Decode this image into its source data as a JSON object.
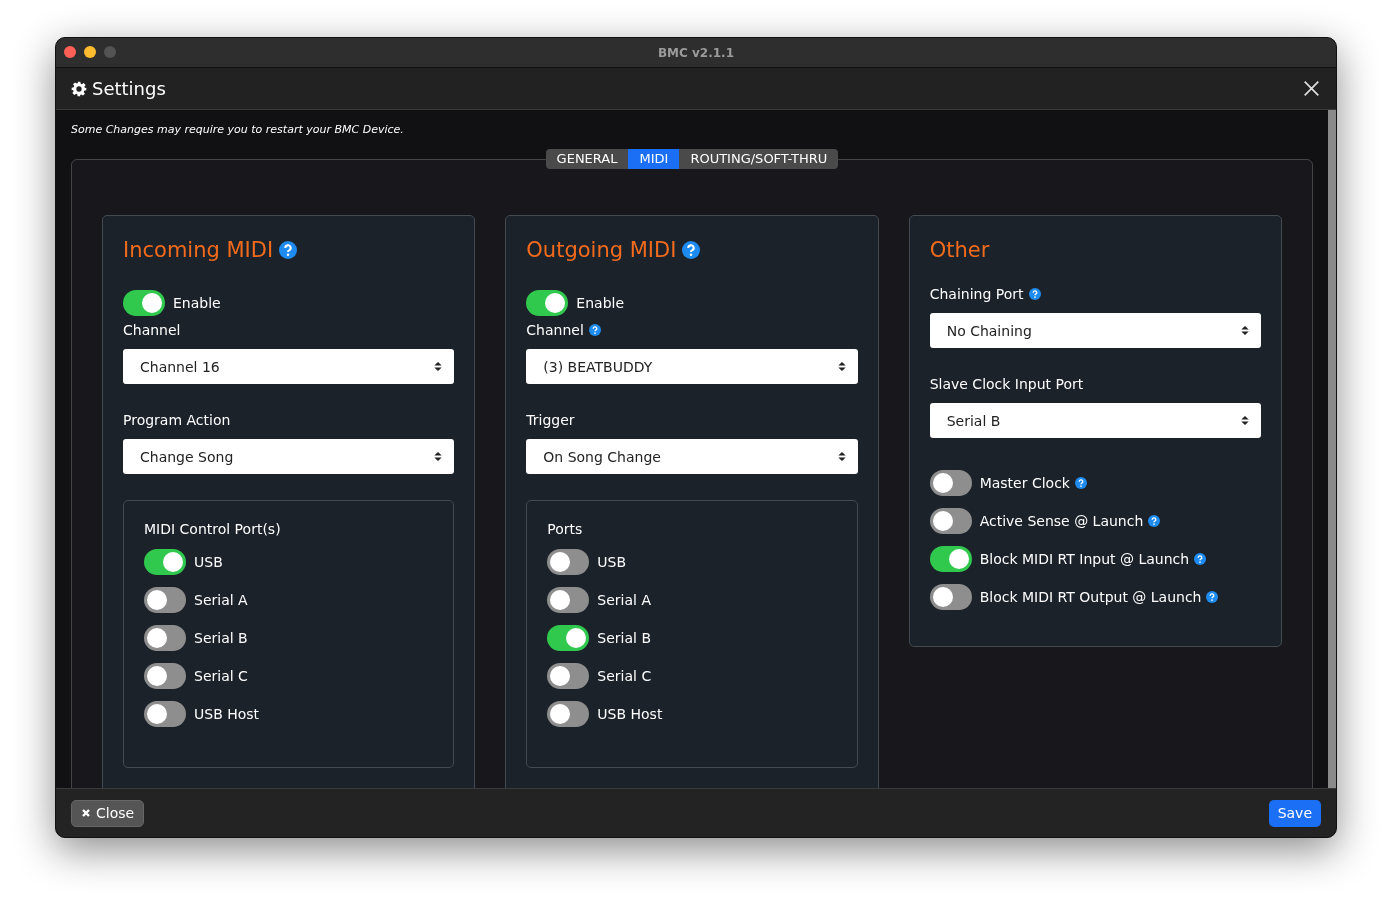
{
  "window": {
    "title": "BMC v2.1.1"
  },
  "header": {
    "title": "Settings"
  },
  "notice": "Some Changes may require you to restart your BMC Device.",
  "tabs": [
    {
      "label": "GENERAL",
      "selected": false
    },
    {
      "label": "MIDI",
      "selected": true
    },
    {
      "label": "ROUTING/SOFT-THRU",
      "selected": false
    }
  ],
  "panels": [
    {
      "title": "Incoming MIDI",
      "help": true,
      "items": [
        {
          "kind": "toggle",
          "label": "Enable",
          "on": true,
          "help": false
        },
        {
          "kind": "select",
          "label": "Channel",
          "help": false,
          "value": "Channel 16"
        },
        {
          "kind": "select",
          "label": "Program Action",
          "help": false,
          "value": "Change Song"
        },
        {
          "kind": "group",
          "title": "MIDI Control Port(s)",
          "items": [
            {
              "kind": "toggle",
              "label": "USB",
              "on": true,
              "help": false
            },
            {
              "kind": "toggle",
              "label": "Serial A",
              "on": false,
              "help": false
            },
            {
              "kind": "toggle",
              "label": "Serial B",
              "on": false,
              "help": false
            },
            {
              "kind": "toggle",
              "label": "Serial C",
              "on": false,
              "help": false
            },
            {
              "kind": "toggle",
              "label": "USB Host",
              "on": false,
              "help": false
            }
          ]
        }
      ]
    },
    {
      "title": "Outgoing MIDI",
      "help": true,
      "items": [
        {
          "kind": "toggle",
          "label": "Enable",
          "on": true,
          "help": false
        },
        {
          "kind": "select",
          "label": "Channel",
          "help": true,
          "value": "(3) BEATBUDDY"
        },
        {
          "kind": "select",
          "label": "Trigger",
          "help": false,
          "value": "On Song Change"
        },
        {
          "kind": "group",
          "title": "Ports",
          "items": [
            {
              "kind": "toggle",
              "label": "USB",
              "on": false,
              "help": false
            },
            {
              "kind": "toggle",
              "label": "Serial A",
              "on": false,
              "help": false
            },
            {
              "kind": "toggle",
              "label": "Serial B",
              "on": true,
              "help": false
            },
            {
              "kind": "toggle",
              "label": "Serial C",
              "on": false,
              "help": false
            },
            {
              "kind": "toggle",
              "label": "USB Host",
              "on": false,
              "help": false
            }
          ]
        }
      ]
    },
    {
      "title": "Other",
      "help": false,
      "items": [
        {
          "kind": "select",
          "label": "Chaining Port",
          "help": true,
          "value": "No Chaining"
        },
        {
          "kind": "select",
          "label": "Slave Clock Input Port",
          "help": false,
          "value": "Serial B"
        },
        {
          "kind": "toggle",
          "label": "Master Clock",
          "on": false,
          "help": true
        },
        {
          "kind": "toggle",
          "label": "Active Sense @ Launch",
          "on": false,
          "help": true
        },
        {
          "kind": "toggle",
          "label": "Block MIDI RT Input @ Launch",
          "on": true,
          "help": true
        },
        {
          "kind": "toggle",
          "label": "Block MIDI RT Output @ Launch",
          "on": false,
          "help": true
        }
      ]
    }
  ],
  "footer": {
    "close": "Close",
    "save": "Save"
  }
}
